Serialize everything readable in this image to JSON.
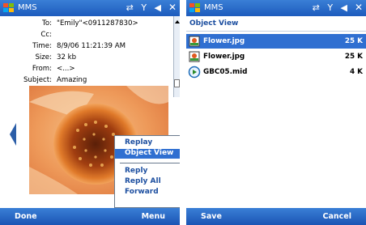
{
  "left_screen": {
    "titlebar": {
      "title": "MMS",
      "status_icons": "⇄ Y ◀",
      "close_label": "✕"
    },
    "header": {
      "to_label": "To:",
      "to_value": "\"Emily\"<0911287830>",
      "cc_label": "Cc:",
      "cc_value": "",
      "time_label": "Time:",
      "time_value": "8/9/06 11:21:39 AM",
      "size_label": "Size:",
      "size_value": "32 kb",
      "from_label": "From:",
      "from_value": "<...>",
      "subject_label": "Subject:",
      "subject_value": "Amazing"
    },
    "menu": {
      "items": [
        "Replay",
        "Object View",
        "Reply",
        "Reply All",
        "Forward"
      ]
    },
    "softkeys": {
      "left": "Done",
      "right": "Menu"
    }
  },
  "right_screen": {
    "titlebar": {
      "title": "MMS",
      "status_icons": "⇄ Y ◀",
      "close_label": "✕"
    },
    "section_title": "Object View",
    "files": [
      {
        "name": "Flower.jpg",
        "size": "25 K",
        "icon": "image-file-icon"
      },
      {
        "name": "Flower.jpg",
        "size": "25 K",
        "icon": "image-file-icon"
      },
      {
        "name": "GBC05.mid",
        "size": "4 K",
        "icon": "audio-file-icon"
      }
    ],
    "softkeys": {
      "left": "Save",
      "right": "Cancel"
    }
  },
  "colors": {
    "accent": "#2f6fd1",
    "titlebar": "#1d5bbd",
    "menu_text": "#1d4fa0"
  }
}
